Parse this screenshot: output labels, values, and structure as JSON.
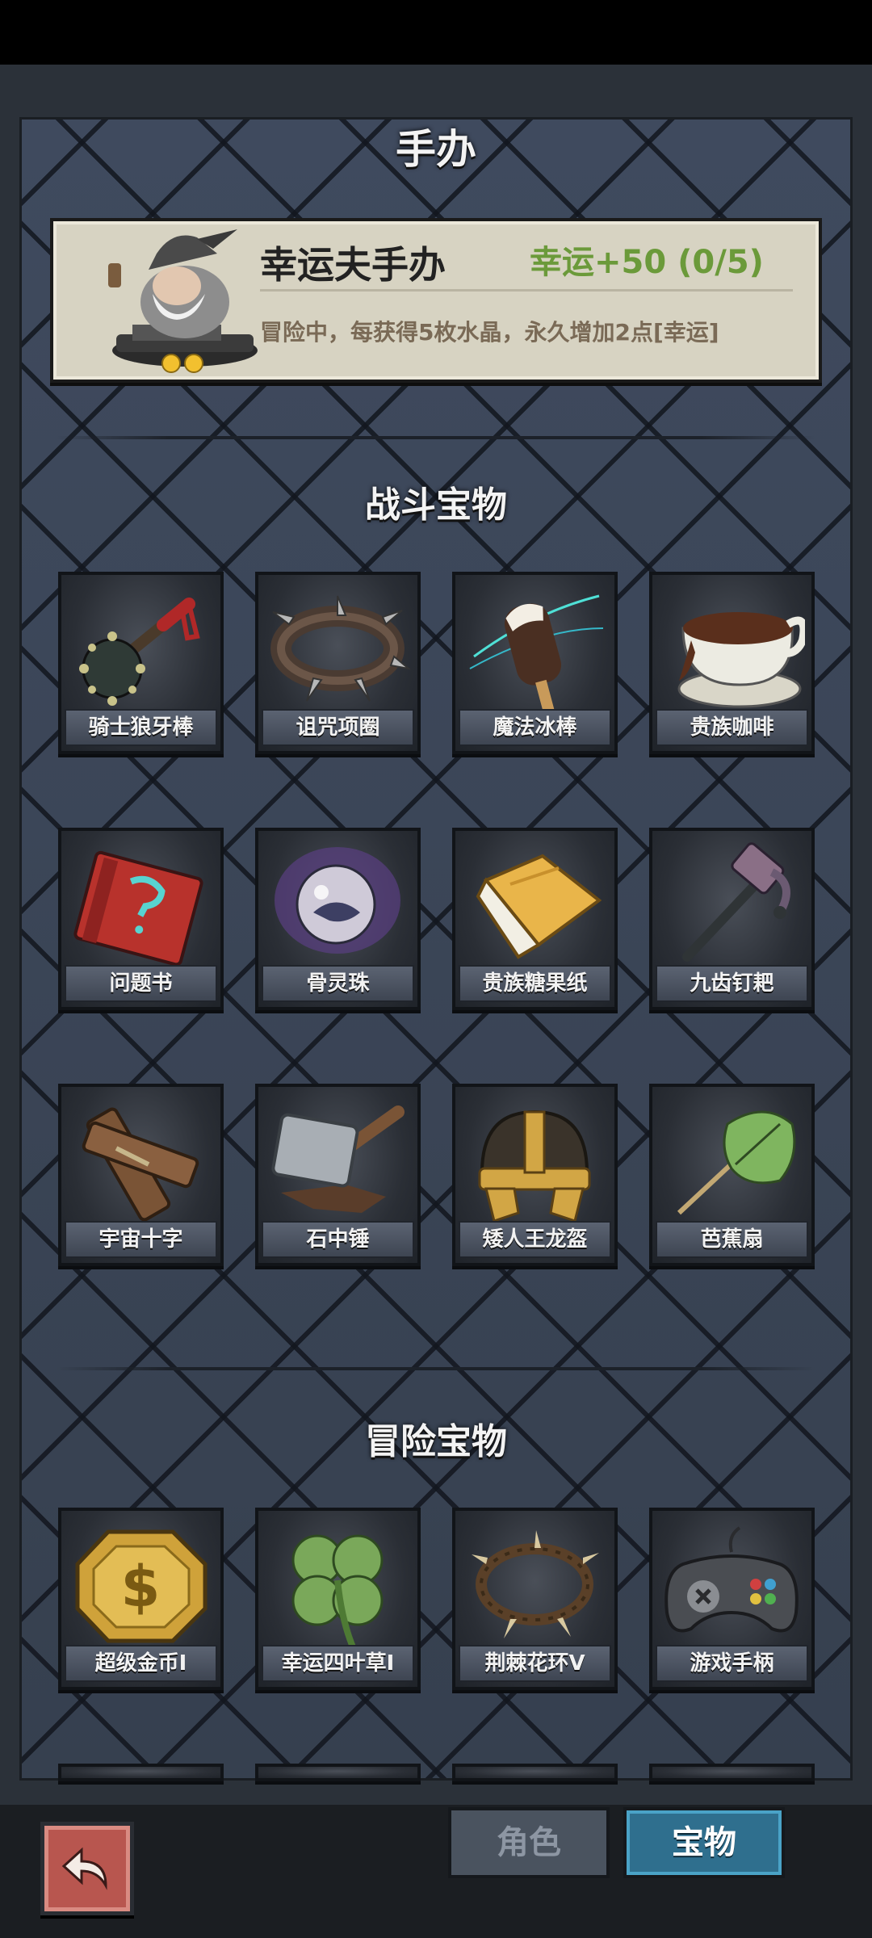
{
  "page": {
    "title": "手办"
  },
  "figure": {
    "name": "幸运夫手办",
    "bonus": "幸运+50 (0/5)",
    "description": "冒险中，每获得5枚水晶，永久增加2点[幸运]",
    "stars": 2,
    "icon": "wizard-figurine-icon"
  },
  "sections": {
    "combat": {
      "title": "战斗宝物"
    },
    "adventure": {
      "title": "冒险宝物"
    }
  },
  "combat_items": [
    {
      "label": "骑士狼牙棒",
      "icon": "spiked-mace-icon"
    },
    {
      "label": "诅咒项圈",
      "icon": "spiked-collar-icon"
    },
    {
      "label": "魔法冰棒",
      "icon": "magic-popsicle-icon"
    },
    {
      "label": "贵族咖啡",
      "icon": "coffee-cup-icon"
    },
    {
      "label": "问题书",
      "icon": "question-book-icon"
    },
    {
      "label": "骨灵珠",
      "icon": "spirit-orb-icon"
    },
    {
      "label": "贵族糖果纸",
      "icon": "candy-wrapper-icon"
    },
    {
      "label": "九齿钉耙",
      "icon": "nine-tooth-rake-icon"
    },
    {
      "label": "宇宙十字",
      "icon": "wooden-cross-icon"
    },
    {
      "label": "石中锤",
      "icon": "stone-hammer-icon"
    },
    {
      "label": "矮人王龙盔",
      "icon": "dwarf-helmet-icon"
    },
    {
      "label": "芭蕉扇",
      "icon": "leaf-fan-icon"
    }
  ],
  "adventure_items": [
    {
      "label": "超级金币I",
      "icon": "gold-coin-icon"
    },
    {
      "label": "幸运四叶草I",
      "icon": "four-leaf-clover-icon"
    },
    {
      "label": "荆棘花环V",
      "icon": "thorn-wreath-icon"
    },
    {
      "label": "游戏手柄",
      "icon": "gamepad-icon"
    }
  ],
  "tabs": {
    "role": "角色",
    "treasure": "宝物",
    "active": "treasure"
  },
  "colors": {
    "accent_green": "#6b9a3a",
    "active_tab": "#2f6f8e",
    "back_button": "#b8564f"
  }
}
